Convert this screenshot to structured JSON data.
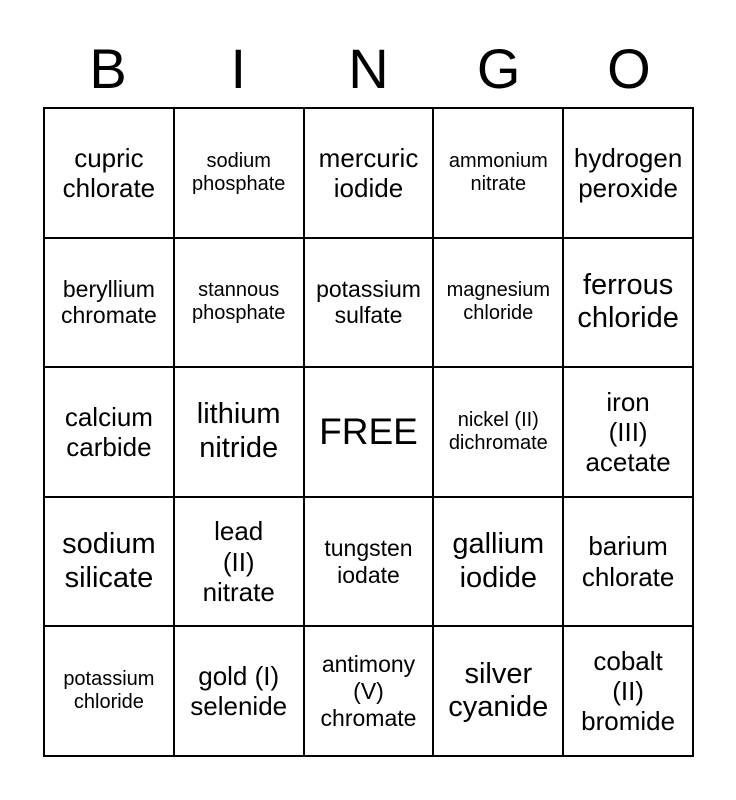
{
  "card": {
    "title_letters": [
      "B",
      "I",
      "N",
      "G",
      "O"
    ],
    "free_label": "FREE",
    "rows": [
      [
        {
          "text": "cupric\nchlorate",
          "size": "fs-lg"
        },
        {
          "text": "sodium\nphosphate",
          "size": "fs-sm"
        },
        {
          "text": "mercuric\niodide",
          "size": "fs-lg"
        },
        {
          "text": "ammonium\nnitrate",
          "size": "fs-sm"
        },
        {
          "text": "hydrogen\nperoxide",
          "size": "fs-lg"
        }
      ],
      [
        {
          "text": "beryllium\nchromate",
          "size": "fs-md"
        },
        {
          "text": "stannous\nphosphate",
          "size": "fs-sm"
        },
        {
          "text": "potassium\nsulfate",
          "size": "fs-md"
        },
        {
          "text": "magnesium\nchloride",
          "size": "fs-sm"
        },
        {
          "text": "ferrous\nchloride",
          "size": "fs-xl"
        }
      ],
      [
        {
          "text": "calcium\ncarbide",
          "size": "fs-lg"
        },
        {
          "text": "lithium\nnitride",
          "size": "fs-xl"
        },
        {
          "text": "FREE",
          "size": "fs-free"
        },
        {
          "text": "nickel (II)\ndichromate",
          "size": "fs-sm"
        },
        {
          "text": "iron\n(III)\nacetate",
          "size": "fs-lg"
        }
      ],
      [
        {
          "text": "sodium\nsilicate",
          "size": "fs-xl"
        },
        {
          "text": "lead\n(II)\nnitrate",
          "size": "fs-lg"
        },
        {
          "text": "tungsten\niodate",
          "size": "fs-md"
        },
        {
          "text": "gallium\niodide",
          "size": "fs-xl"
        },
        {
          "text": "barium\nchlorate",
          "size": "fs-lg"
        }
      ],
      [
        {
          "text": "potassium\nchloride",
          "size": "fs-sm"
        },
        {
          "text": "gold (I)\nselenide",
          "size": "fs-lg"
        },
        {
          "text": "antimony\n(V)\nchromate",
          "size": "fs-md"
        },
        {
          "text": "silver\ncyanide",
          "size": "fs-xl"
        },
        {
          "text": "cobalt\n(II)\nbromide",
          "size": "fs-lg"
        }
      ]
    ]
  }
}
